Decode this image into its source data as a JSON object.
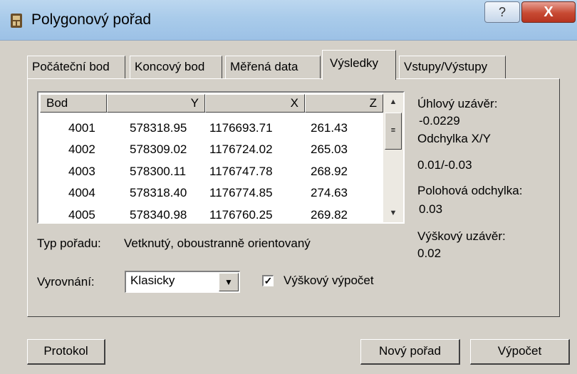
{
  "window": {
    "title": "Polygonový pořad",
    "help_label": "?",
    "close_label": "X"
  },
  "tabs": [
    {
      "label": "Počáteční bod"
    },
    {
      "label": "Koncový bod"
    },
    {
      "label": "Měřená data"
    },
    {
      "label": "Výsledky",
      "active": true
    },
    {
      "label": "Vstupy/Výstupy"
    }
  ],
  "table": {
    "columns": [
      "Bod",
      "Y",
      "X",
      "Z"
    ],
    "rows": [
      [
        "4001",
        "578318.95",
        "1176693.71",
        "261.43"
      ],
      [
        "4002",
        "578309.02",
        "1176724.02",
        "265.03"
      ],
      [
        "4003",
        "578300.11",
        "1176747.78",
        "268.92"
      ],
      [
        "4004",
        "578318.40",
        "1176774.85",
        "274.63"
      ],
      [
        "4005",
        "578340.98",
        "1176760.25",
        "269.82"
      ]
    ]
  },
  "results": {
    "angular_label": "Úhlový uzávěr:",
    "angular_value": "-0.0229",
    "deviation_label": "Odchylka X/Y",
    "deviation_value": "0.01/-0.03",
    "position_label": "Polohová odchylka:",
    "position_value": "0.03",
    "height_label": "Výškový uzávěr:",
    "height_value": "0.02"
  },
  "traverse": {
    "label": "Typ pořadu:",
    "value": "Vetknutý, oboustranně orientovaný"
  },
  "adjustment": {
    "label": "Vyrovnání:",
    "value": "Klasicky"
  },
  "height_calc": {
    "label": "Výškový výpočet",
    "checked": true
  },
  "buttons": {
    "protocol": "Protokol",
    "new_traverse": "Nový pořad",
    "calculate": "Výpočet"
  }
}
